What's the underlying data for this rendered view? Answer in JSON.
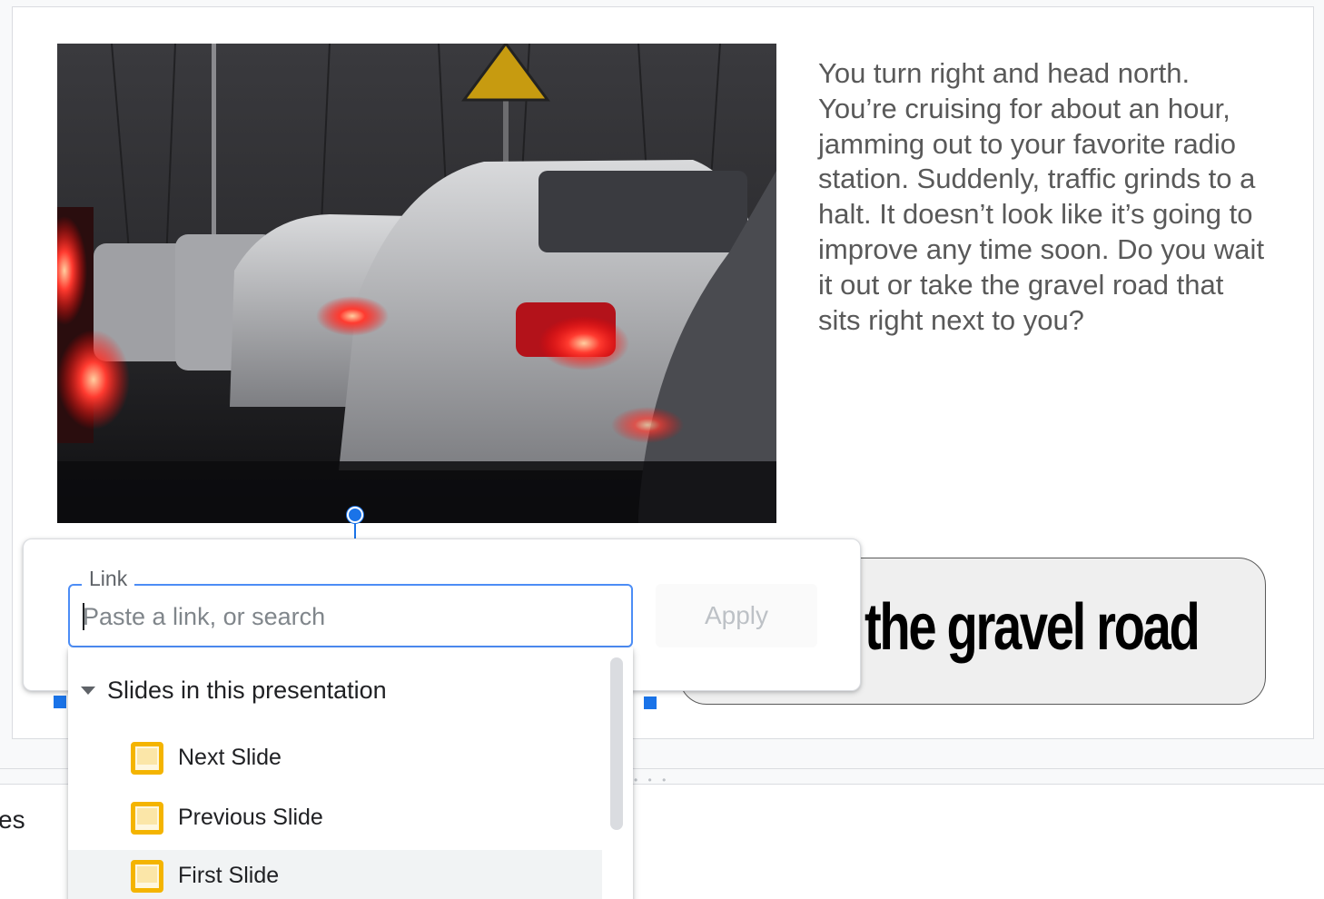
{
  "slide": {
    "story_text": "You turn right and head north. You’re cruising for about an hour, jamming out to your favorite radio station. Suddenly, traffic grinds to a halt. It doesn’t look like it’s going to improve any time soon. Do you wait it out or take the gravel road that sits right next to you?",
    "gravel_button_label": "the gravel road"
  },
  "notes": {
    "partial_text": "es"
  },
  "link_popup": {
    "field_label": "Link",
    "placeholder": "Paste a link, or search",
    "apply_label": "Apply",
    "section_label": "Slides in this presentation",
    "items": [
      {
        "label": "Next Slide",
        "icon": "slide-icon"
      },
      {
        "label": "Previous Slide",
        "icon": "slide-icon"
      },
      {
        "label": "First Slide",
        "icon": "slide-icon"
      }
    ]
  },
  "colors": {
    "accent": "#1a73e8",
    "focus_border": "#4c8df6",
    "slide_icon": "#f4b400"
  }
}
